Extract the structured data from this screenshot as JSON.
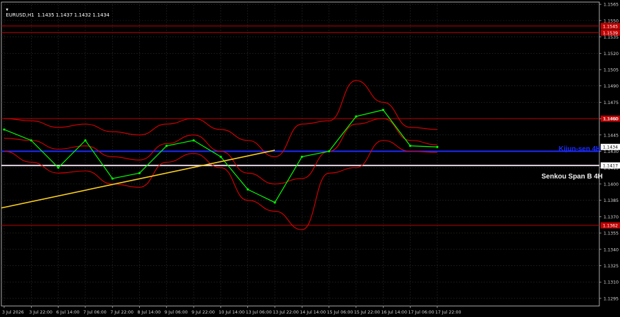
{
  "window": {
    "symbol_header": "EURUSD,H1  1.1435 1.1437 1.1432 1.1434"
  },
  "chart_data": {
    "type": "line",
    "title": "EURUSD,H1",
    "ohlc_header": {
      "open": 1.1435,
      "high": 1.1437,
      "low": 1.1432,
      "close": 1.1434
    },
    "price_axis": {
      "ylim": [
        1.1288,
        1.1567
      ],
      "ticks": [
        "1.1565",
        "1.1550",
        "1.1535",
        "1.1520",
        "1.1505",
        "1.1490",
        "1.1475",
        "1.1460",
        "1.1445",
        "1.1430",
        "1.1415",
        "1.1400",
        "1.1385",
        "1.1370",
        "1.1355",
        "1.1340",
        "1.1325",
        "1.1310",
        "1.1295"
      ]
    },
    "time_axis": {
      "ticks": [
        "3 Jul 2026",
        "3 Jul 22:00",
        "6 Jul 14:00",
        "7 Jul 06:00",
        "7 Jul 22:00",
        "8 Jul 14:00",
        "9 Jul 06:00",
        "9 Jul 22:00",
        "10 Jul 14:00",
        "13 Jul 06:00",
        "13 Jul 22:00",
        "14 Jul 14:00",
        "15 Jul 06:00",
        "15 Jul 22:00",
        "16 Jul 14:00",
        "17 Jul 06:00",
        "17 Jul 22:00"
      ]
    },
    "horizontal_levels": [
      {
        "price": 1.1545,
        "label": "1.1545",
        "color": "#c00000"
      },
      {
        "price": 1.1539,
        "label": "1.1539",
        "color": "#c00000"
      },
      {
        "price": 1.146,
        "label": "1.1460",
        "color": "#c00000"
      },
      {
        "price": 1.1362,
        "label": "1.1362",
        "color": "#c00000"
      }
    ],
    "indicator_lines": [
      {
        "name": "Kijun-sen 4H",
        "price": 1.143,
        "color": "#1b2bff"
      },
      {
        "name": "Senkou Span B 4H",
        "price": 1.1417,
        "color": "#e6d8e6"
      }
    ],
    "current_price": "1.1434",
    "trend_line": {
      "color": "#ffd21f",
      "from": [
        "3 Jul 2026",
        1.1378
      ],
      "to": [
        "13 Jul 22:00",
        1.1431
      ]
    },
    "price_series": {
      "name": "EURUSD H1",
      "color": "#00ff00",
      "x": [
        "3 Jul 2026",
        "3 Jul 22:00",
        "6 Jul 14:00",
        "7 Jul 06:00",
        "7 Jul 22:00",
        "8 Jul 14:00",
        "9 Jul 06:00",
        "9 Jul 22:00",
        "10 Jul 14:00",
        "13 Jul 06:00",
        "13 Jul 22:00",
        "14 Jul 14:00",
        "15 Jul 06:00",
        "15 Jul 22:00",
        "16 Jul 14:00",
        "17 Jul 06:00",
        "17 Jul 22:00"
      ],
      "y": [
        1.145,
        1.144,
        1.1415,
        1.144,
        1.1405,
        1.141,
        1.1435,
        1.144,
        1.1425,
        1.1395,
        1.1383,
        1.1425,
        1.143,
        1.1462,
        1.1468,
        1.1435,
        1.1434
      ]
    },
    "bollinger_bands": {
      "color": "#e00000",
      "upper": [
        1.146,
        1.1458,
        1.1452,
        1.1455,
        1.1448,
        1.1445,
        1.1455,
        1.146,
        1.145,
        1.144,
        1.1425,
        1.1455,
        1.1458,
        1.1495,
        1.1475,
        1.1452,
        1.145
      ],
      "middle": [
        1.1442,
        1.144,
        1.1432,
        1.1435,
        1.1425,
        1.1422,
        1.1437,
        1.1445,
        1.143,
        1.141,
        1.14,
        1.1405,
        1.143,
        1.1455,
        1.146,
        1.144,
        1.1436
      ],
      "lower": [
        1.143,
        1.142,
        1.141,
        1.1412,
        1.14,
        1.1397,
        1.142,
        1.1428,
        1.1415,
        1.1385,
        1.1375,
        1.1358,
        1.141,
        1.1415,
        1.144,
        1.143,
        1.1429
      ]
    }
  }
}
